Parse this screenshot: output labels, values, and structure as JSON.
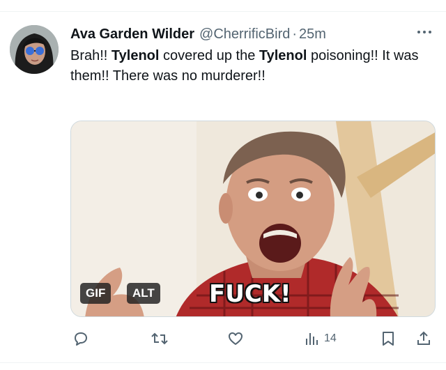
{
  "tweet": {
    "author_name": "Ava Garden Wilder",
    "handle": "@CherrificBird",
    "separator": "·",
    "time": "25m",
    "text": [
      {
        "t": "Brah!! "
      },
      {
        "t": "Tylenol",
        "bold": true
      },
      {
        "t": " covered up the "
      },
      {
        "t": "Tylenol",
        "bold": true
      },
      {
        "t": " poisoning!! It was them!! There was no murderer!!"
      }
    ]
  },
  "media": {
    "gif_badge": "GIF",
    "alt_badge": "ALT",
    "caption": "FUCK!"
  },
  "actions": {
    "views_count": "14"
  },
  "colors": {
    "text": "#0f1419",
    "secondary": "#536471",
    "divider": "#eff3f4"
  }
}
